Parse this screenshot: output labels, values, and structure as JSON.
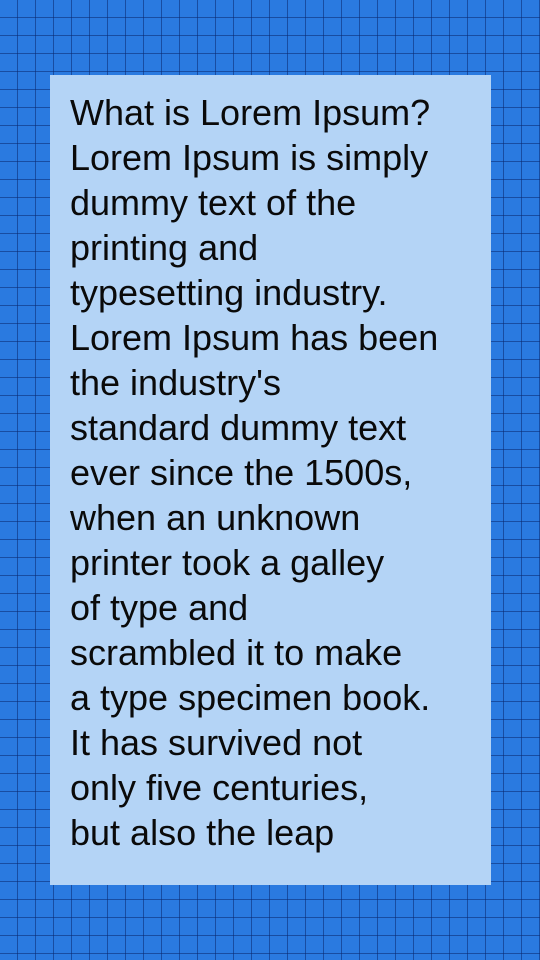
{
  "card": {
    "lines": [
      "What is Lorem Ipsum?",
      "Lorem Ipsum is simply",
      "dummy text of the",
      "printing and",
      "typesetting industry.",
      "Lorem Ipsum has been",
      "the industry's",
      "standard dummy text",
      "ever since the 1500s,",
      "when an unknown",
      "printer took a galley",
      "of type and",
      "scrambled it to make",
      "a type specimen book.",
      "It has survived not",
      "only five centuries,",
      "but also the leap"
    ]
  },
  "colors": {
    "background": "#2a7ae0",
    "grid_line": "#0a286e",
    "card_background": "#b4d4f6",
    "text": "#0a0a0a"
  }
}
